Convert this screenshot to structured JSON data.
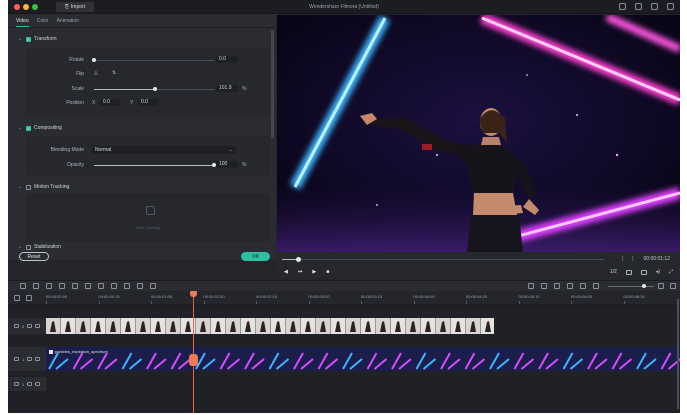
{
  "titlebar": {
    "import_label": "Import",
    "window_title": "Wondershare Filmora (Untitled)",
    "traffic_lights": [
      "#ff5f57",
      "#febc2e",
      "#28c840"
    ]
  },
  "inspector": {
    "tabs": [
      {
        "label": "Video",
        "active": true
      },
      {
        "label": "Color",
        "active": false
      },
      {
        "label": "Animation",
        "active": false
      }
    ],
    "transform": {
      "title": "Transform",
      "enabled": true,
      "rotate": {
        "label": "Rotate",
        "value": "0.0",
        "level": 0
      },
      "flip": {
        "label": "Flip"
      },
      "scale": {
        "label": "Scale",
        "value": "101.9",
        "unit": "%",
        "level": 0.51
      },
      "position": {
        "label": "Position",
        "x_label": "X",
        "x": "0.0",
        "y_label": "Y",
        "y": "0.0"
      }
    },
    "compositing": {
      "title": "Compositing",
      "enabled": true,
      "blending": {
        "label": "Blending Mode",
        "value": "Normal"
      },
      "opacity": {
        "label": "Opacity",
        "value": "100",
        "unit": "%",
        "level": 1.0
      }
    },
    "motion_tracking": {
      "title": "Motion Tracking",
      "enabled": false,
      "start_label": "Start Tracking"
    },
    "stabilization": {
      "title": "Stabilization",
      "enabled": false
    },
    "reset_label": "Reset",
    "ok_label": "OK",
    "accent_color": "#2fbfa3"
  },
  "player": {
    "timecode": "00:00:01:12",
    "progress": 0.05,
    "zoom_option": "1/2"
  },
  "timeline": {
    "ruler_labels": [
      "00:00:00:00",
      "00:00:00:15",
      "00:00:01:05",
      "00:00:01:20",
      "00:00:02:10",
      "00:00:03:00",
      "00:00:03:15",
      "00:00:04:05",
      "00:00:04:20",
      "00:00:05:10",
      "00:00:06:00",
      "00:00:06:15"
    ],
    "tracks": [
      {
        "label": "2"
      },
      {
        "label": "1"
      },
      {
        "label": "1"
      }
    ],
    "effect_clip_name": "particles_explosion_spectrum",
    "playhead_color": "#f07a52"
  }
}
